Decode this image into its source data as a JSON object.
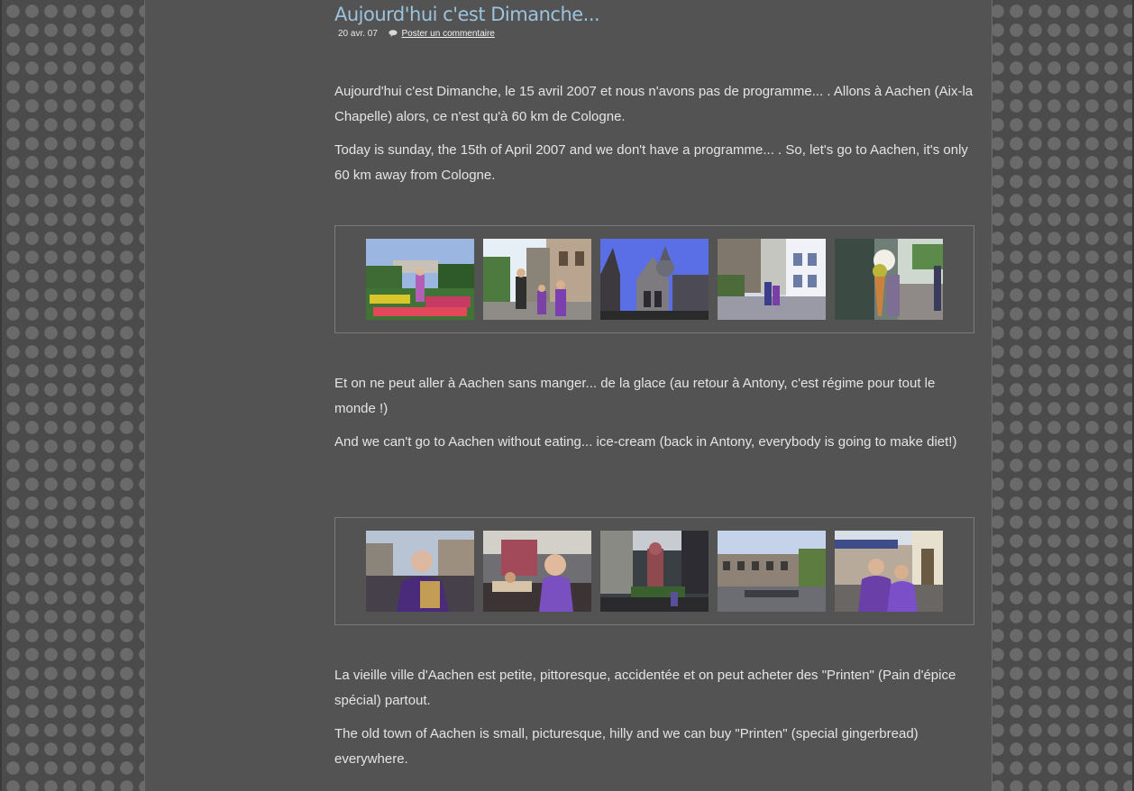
{
  "post": {
    "title": "Aujourd'hui c'est Dimanche...",
    "date": "20 avr. 07",
    "comment_link": "Poster un commentaire",
    "comment_icon": "speech-bubble-icon",
    "paragraphs": [
      "Aujourd'hui c'est Dimanche, le 15 avril 2007 et nous n'avons pas de programme... . Allons à Aachen (Aix-la Chapelle) alors, ce n'est qu'à 60 km de Cologne.",
      "Today is sunday, the 15th of April 2007 and we don't have a programme... . So, let's go to Aachen, it's only 60 km away from Cologne.",
      "Et on ne peut aller à Aachen sans manger... de la glace (au retour à Antony, c'est régime pour tout le monde !)",
      "And we can't go to Aachen without eating... ice-cream (back in Antony, everybody is going to make diet!)",
      "La vieille ville d'Aachen est petite, pittoresque, accidentée et on peut acheter des \"Printen\" (Pain d'épice spécial) partout.",
      "The old town of Aachen is small, picturesque, hilly and we can buy \"Printen\" (special gingerbread) everywhere."
    ],
    "galleries": [
      {
        "photos": [
          "garden",
          "town-square",
          "cathedral",
          "street",
          "ice-cream"
        ]
      },
      {
        "photos": [
          "cafe-man",
          "cafe-girl",
          "statue",
          "market-square",
          "terrace"
        ]
      }
    ]
  },
  "colors": {
    "page_background": "#4b4b4b",
    "content_background": "#535353",
    "title": "#9cc3dd",
    "text": "#e4e4e4"
  }
}
